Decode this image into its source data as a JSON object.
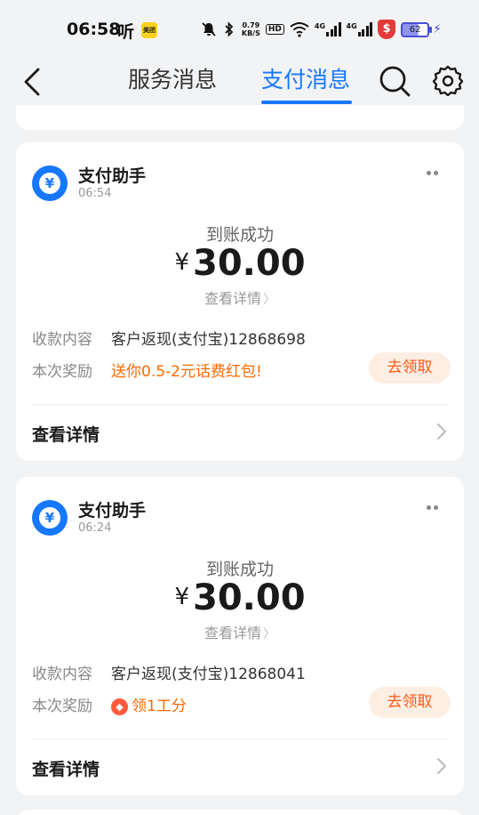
{
  "status_bar": {
    "time": "06:58",
    "ting": "听",
    "meituan": "美团",
    "net_speed_value": "0.79",
    "net_speed_unit": "KB/S",
    "hd": "HD",
    "network_1": "4G",
    "network_2": "4G",
    "security_label": "$",
    "battery": "62"
  },
  "header": {
    "tab_service": "服务消息",
    "tab_pay": "支付消息",
    "active_color": "#1677ff"
  },
  "messages": [
    {
      "sender": "支付助手",
      "time": "06:54",
      "title": "到账成功",
      "currency": "¥",
      "amount": "30.00",
      "details_link": "查看详情",
      "content_label": "收款内容",
      "content_value": "客户返现(支付宝)12868698",
      "reward_label": "本次奖励",
      "reward_value": "送你0.5-2元话费红包!",
      "claim_button": "去领取",
      "view_details": "查看详情"
    },
    {
      "sender": "支付助手",
      "time": "06:24",
      "title": "到账成功",
      "currency": "¥",
      "amount": "30.00",
      "details_link": "查看详情",
      "content_label": "收款内容",
      "content_value": "客户返现(支付宝)12868041",
      "reward_label": "本次奖励",
      "reward_value": "领1工分",
      "claim_button": "去领取",
      "view_details": "查看详情"
    }
  ]
}
